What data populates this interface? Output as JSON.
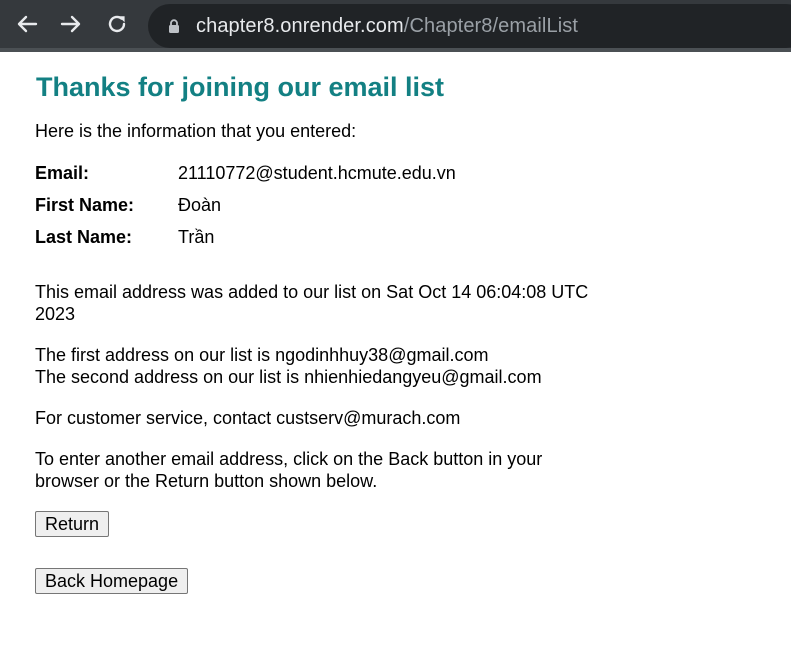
{
  "browser": {
    "url_host": "chapter8.onrender.com",
    "url_path": "/Chapter8/emailList",
    "icons": {
      "back": "arrow-left-icon",
      "forward": "arrow-right-icon",
      "reload": "reload-icon",
      "lock": "lock-icon"
    }
  },
  "page": {
    "title": "Thanks for joining our email list",
    "intro": "Here is the information that you entered:",
    "fields": [
      {
        "label": "Email:",
        "value": "21110772@student.hcmute.edu.vn"
      },
      {
        "label": "First Name:",
        "value": "Đoàn"
      },
      {
        "label": "Last Name:",
        "value": "Trần"
      }
    ],
    "added_text": "This email address was added to our list on Sat Oct 14 06:04:08 UTC 2023",
    "first_address_text": "The first address on our list is ngodinhhuy38@gmail.com",
    "second_address_text": "The second address on our list is nhienhiedangyeu@gmail.com",
    "customer_service_text": "For customer service, contact custserv@murach.com",
    "instructions_text": "To enter another email address, click on the Back button in your browser or the Return button shown below.",
    "return_button": "Return",
    "homepage_button": "Back Homepage"
  },
  "colors": {
    "title": "#138083",
    "chrome_bg": "#35393d",
    "omnibox_bg": "#202326"
  }
}
